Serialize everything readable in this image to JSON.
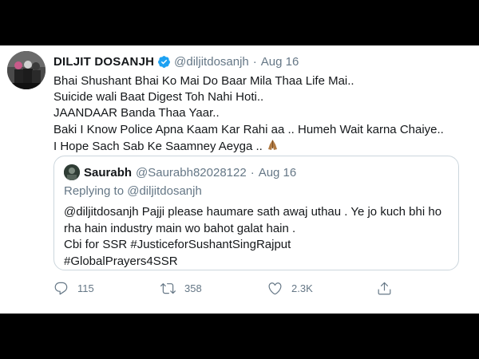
{
  "tweet": {
    "author_name": "DILJIT DOSANJH",
    "author_handle": "@diljitdosanjh",
    "separator": "·",
    "date": "Aug 16",
    "lines": [
      "Bhai Shushant Bhai Ko Mai Do Baar Mila Thaa Life Mai..",
      "Suicide wali Baat Digest Toh Nahi Hoti..",
      "JAANDAAR Banda Thaa Yaar..",
      "Baki I Know Police Apna Kaam Kar Rahi aa .. Humeh Wait karna Chaiye..",
      "I Hope Sach Sab Ke Saamney Aeyga .."
    ],
    "emoji_icon": "folded-hands-emoji",
    "colors": {
      "text": "#14171a",
      "muted": "#657786",
      "verified": "#1da1f2",
      "border": "#ccd6dd"
    }
  },
  "quote": {
    "author_name": "Saurabh",
    "author_handle": "@Saurabh82028122",
    "separator": "·",
    "date": "Aug 16",
    "replying_to": "Replying to @diljitdosanjh",
    "lines": [
      "@diljitdosanjh  Pajji  please haumare sath awaj uthau . Ye jo kuch bhi ho",
      "rha hain industry main wo bahot galat hain .",
      "Cbi for SSR  #JusticeforSushantSingRajput",
      "#GlobalPrayers4SSR"
    ]
  },
  "actions": {
    "reply_count": "115",
    "retweet_count": "358",
    "like_count": "2.3K",
    "icons": [
      "reply-icon",
      "retweet-icon",
      "like-icon",
      "share-icon"
    ]
  }
}
